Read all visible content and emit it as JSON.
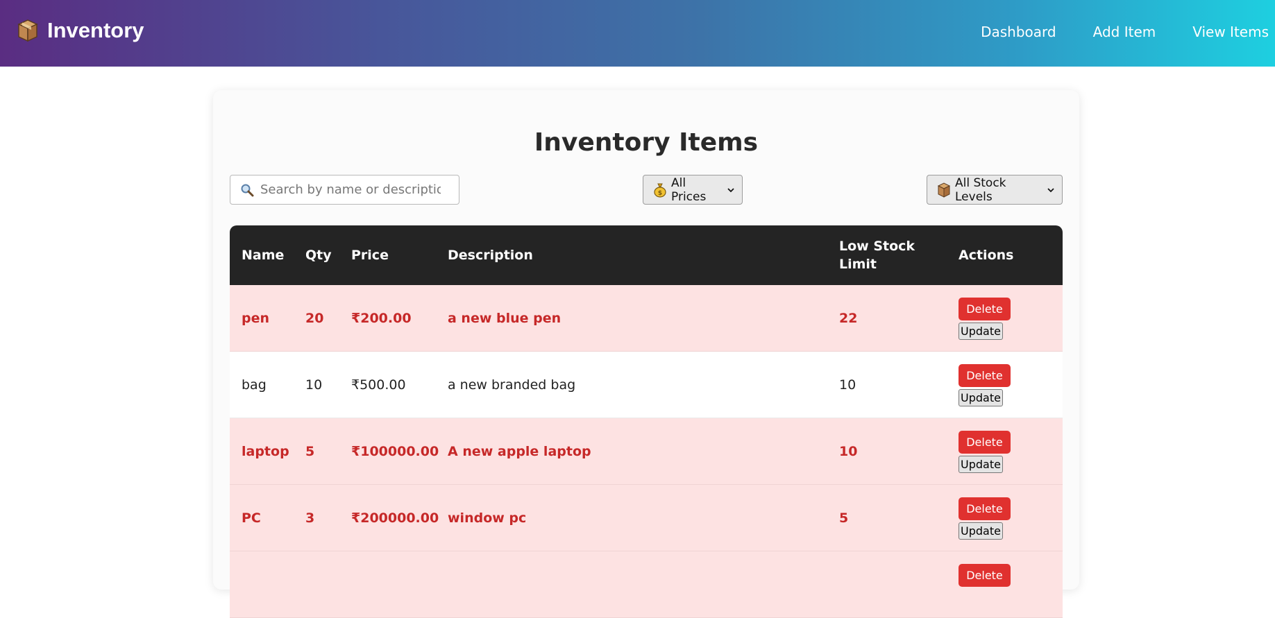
{
  "navbar": {
    "brand": "Inventory",
    "links": [
      "Dashboard",
      "Add Item",
      "View Items"
    ]
  },
  "page": {
    "title": "Inventory Items"
  },
  "filters": {
    "search_placeholder": "Search by name or description...",
    "price_select": "All Prices",
    "stock_select": "All Stock Levels"
  },
  "table": {
    "headers": [
      "Name",
      "Qty",
      "Price",
      "Description",
      "Low Stock Limit",
      "Actions"
    ],
    "rows": [
      {
        "name": "pen",
        "qty": "20",
        "price": "₹200.00",
        "description": "a new blue pen",
        "low_stock": "22",
        "status": "low"
      },
      {
        "name": "bag",
        "qty": "10",
        "price": "₹500.00",
        "description": "a new branded bag",
        "low_stock": "10",
        "status": "ok"
      },
      {
        "name": "laptop",
        "qty": "5",
        "price": "₹100000.00",
        "description": "A new apple laptop",
        "low_stock": "10",
        "status": "low"
      },
      {
        "name": "PC",
        "qty": "3",
        "price": "₹200000.00",
        "description": "window pc",
        "low_stock": "5",
        "status": "low"
      },
      {
        "name": "",
        "qty": "",
        "price": "",
        "description": "",
        "low_stock": "",
        "status": "low"
      }
    ],
    "delete_label": "Delete",
    "update_label": "Update"
  },
  "colors": {
    "low_stock_row_bg": "#fde2e2",
    "low_stock_text": "#c62828",
    "header_bg": "#242424",
    "delete_button": "#e0312f"
  },
  "icons": {
    "brand": "package-icon",
    "search": "magnifier-icon",
    "price": "money-bag-icon",
    "stock": "package-icon"
  }
}
